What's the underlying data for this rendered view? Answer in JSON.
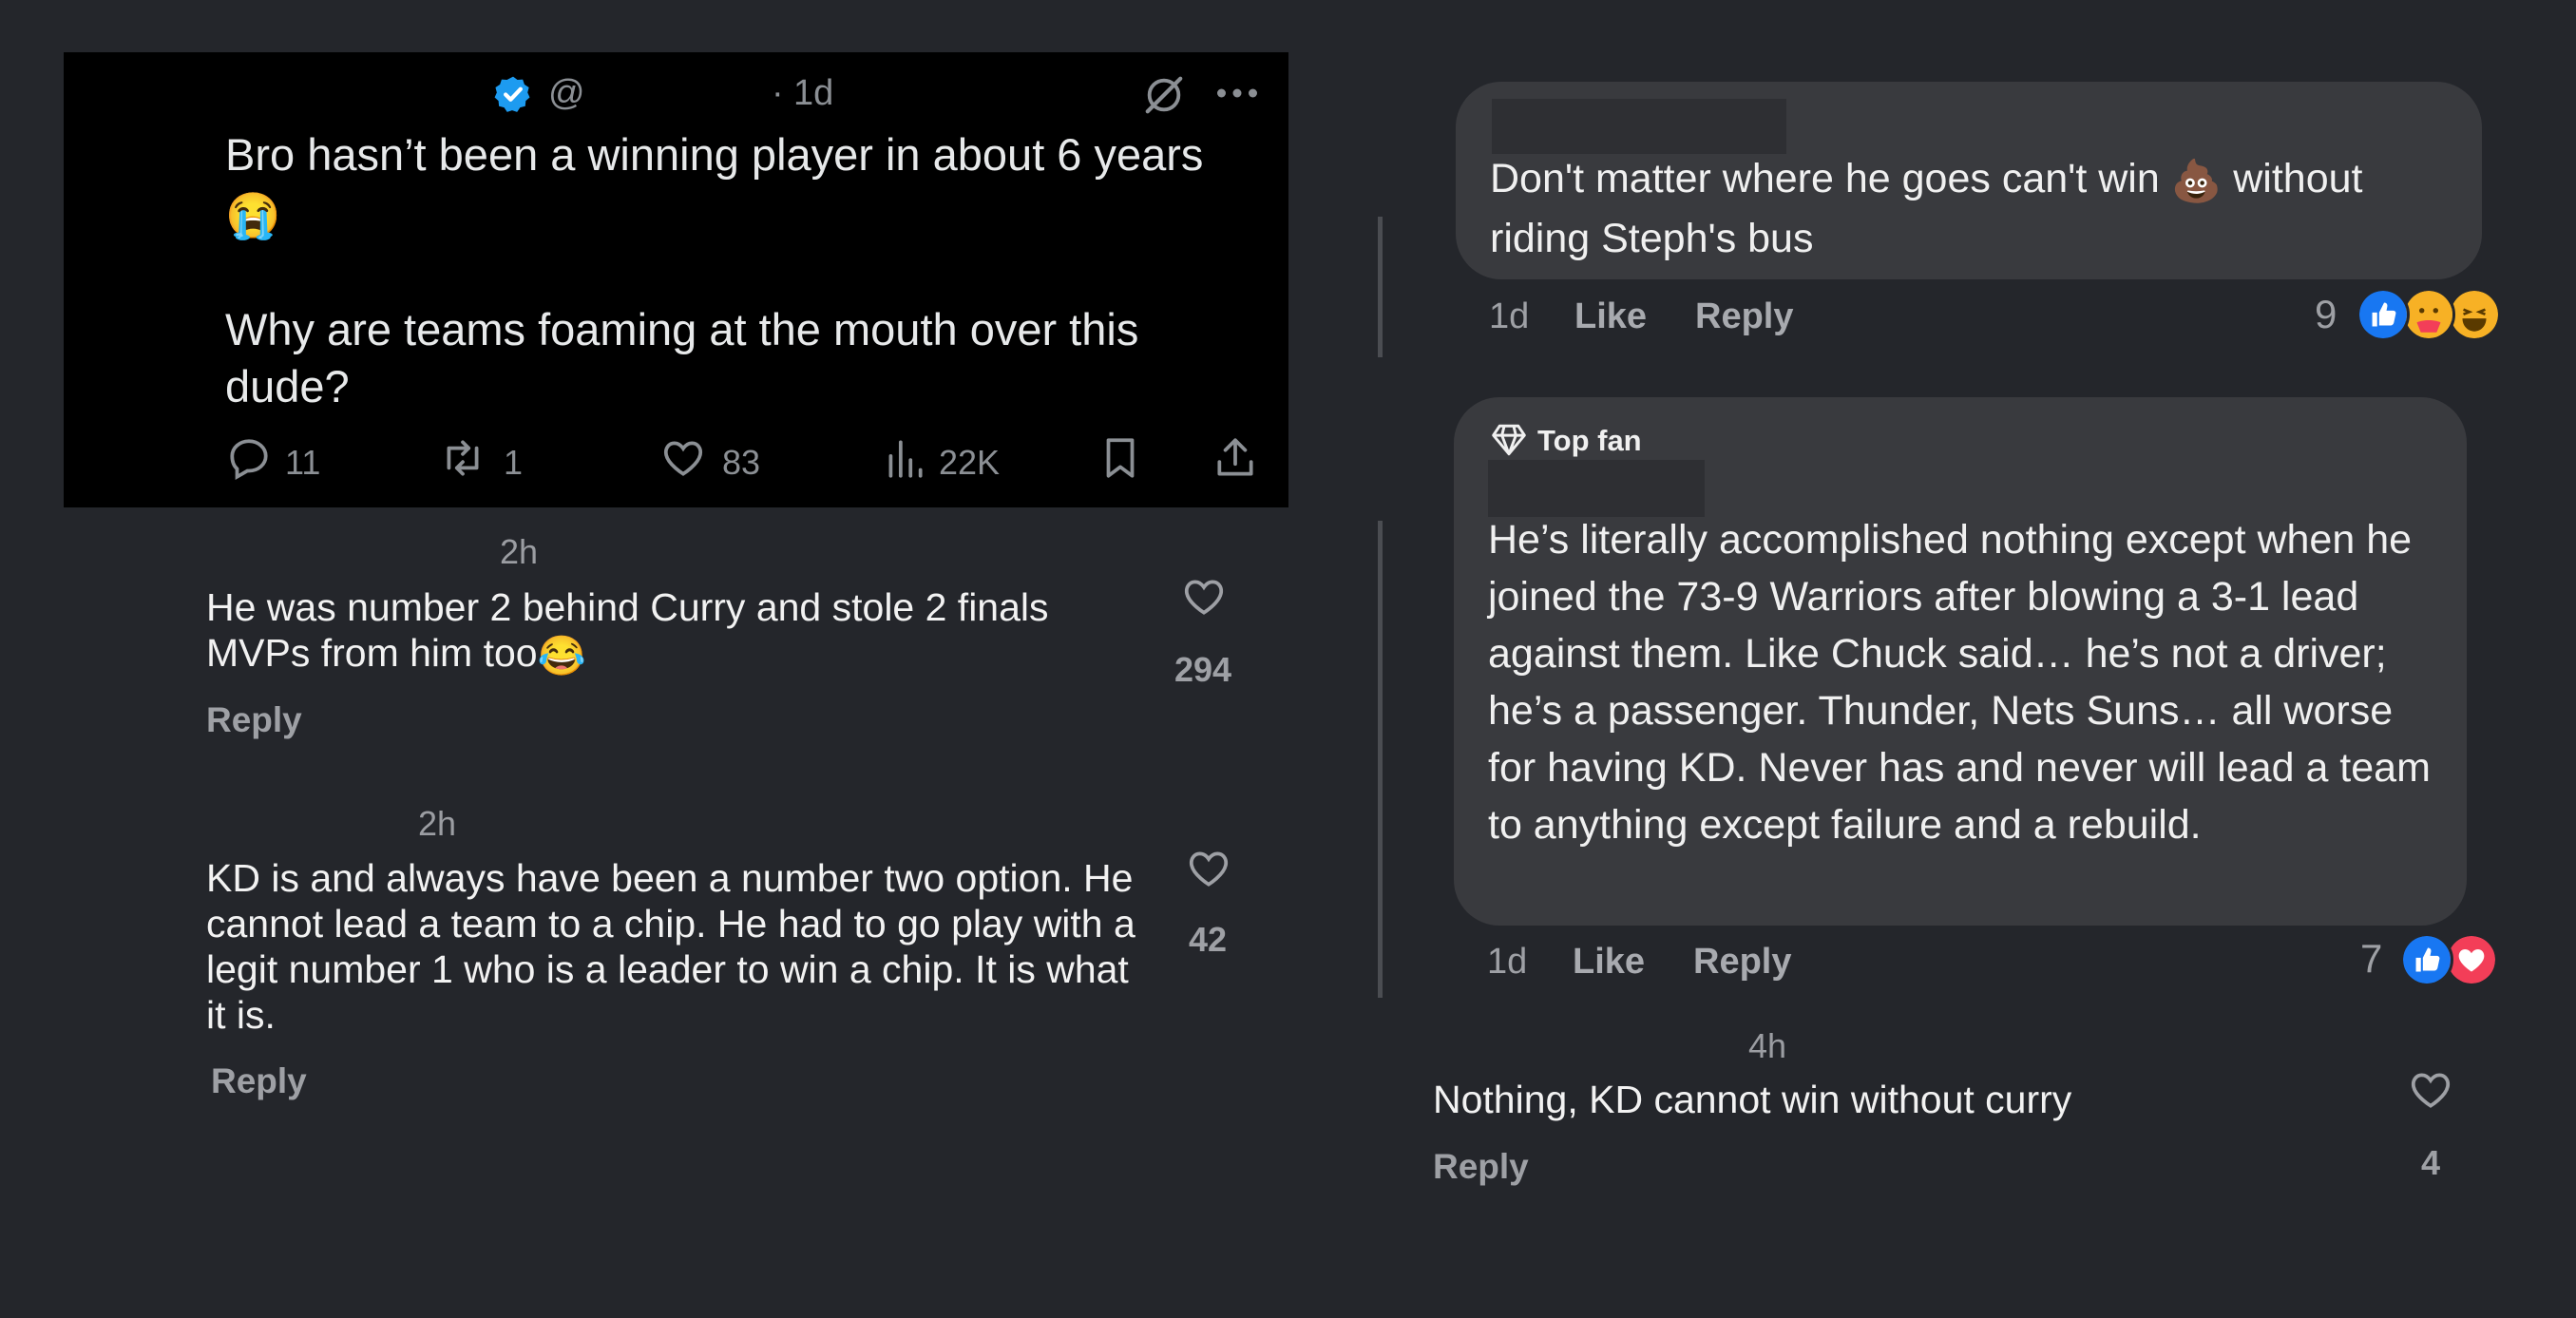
{
  "tweet": {
    "handle": "@",
    "separator": "·",
    "time": "1d",
    "text_line1": "Bro hasn’t been a winning player in about 6 years",
    "text_emoji": "😭",
    "text_para2": "Why are teams foaming at the mouth over this dude?",
    "replies": "11",
    "retweets": "1",
    "likes": "83",
    "views": "22K",
    "icons": [
      "verified-badge-icon",
      "grok-icon",
      "more-icon",
      "reply-icon",
      "retweet-icon",
      "like-icon",
      "views-icon",
      "bookmark-icon",
      "share-icon"
    ],
    "colors": {
      "verified": "#1d9bf0",
      "muted": "#8b8f94"
    }
  },
  "left_comments": [
    {
      "time": "2h",
      "text": "He was number 2 behind Curry and stole 2 finals MVPs from him too",
      "emoji": "😂",
      "reply": "Reply",
      "likes": "294"
    },
    {
      "time": "2h",
      "text": "KD is and always have been a number two option. He cannot lead a team to a chip. He had to go play with a legit number 1 who is a leader to win a chip. It is what it is.",
      "reply": "Reply",
      "likes": "42"
    }
  ],
  "fb_comments": [
    {
      "text_before": "Don't matter where he goes can't win ",
      "emoji": "💩",
      "text_after": " without riding Steph's bus",
      "time": "1d",
      "like": "Like",
      "reply": "Reply",
      "reaction_count": "9",
      "reactions": [
        "like-reaction-icon",
        "care-reaction-icon",
        "haha-reaction-icon"
      ]
    },
    {
      "badge": "Top fan",
      "text": "He’s literally accomplished nothing except when he joined the 73-9 Warriors after blowing a 3-1 lead against them. Like Chuck said… he’s not a driver; he’s a passenger. Thunder, Nets Suns… all worse for having KD. Never has and never will lead a team to anything except failure and a rebuild.",
      "time": "1d",
      "like": "Like",
      "reply": "Reply",
      "reaction_count": "7",
      "reactions": [
        "like-reaction-icon",
        "love-reaction-icon"
      ]
    }
  ],
  "bottom_comment": {
    "time": "4h",
    "text": "Nothing, KD cannot win without curry",
    "reply": "Reply",
    "likes": "4"
  },
  "colors": {
    "background": "#24262b",
    "bubble": "#393a3e",
    "like_blue": "#1877f2",
    "love_red": "#f33e58"
  }
}
